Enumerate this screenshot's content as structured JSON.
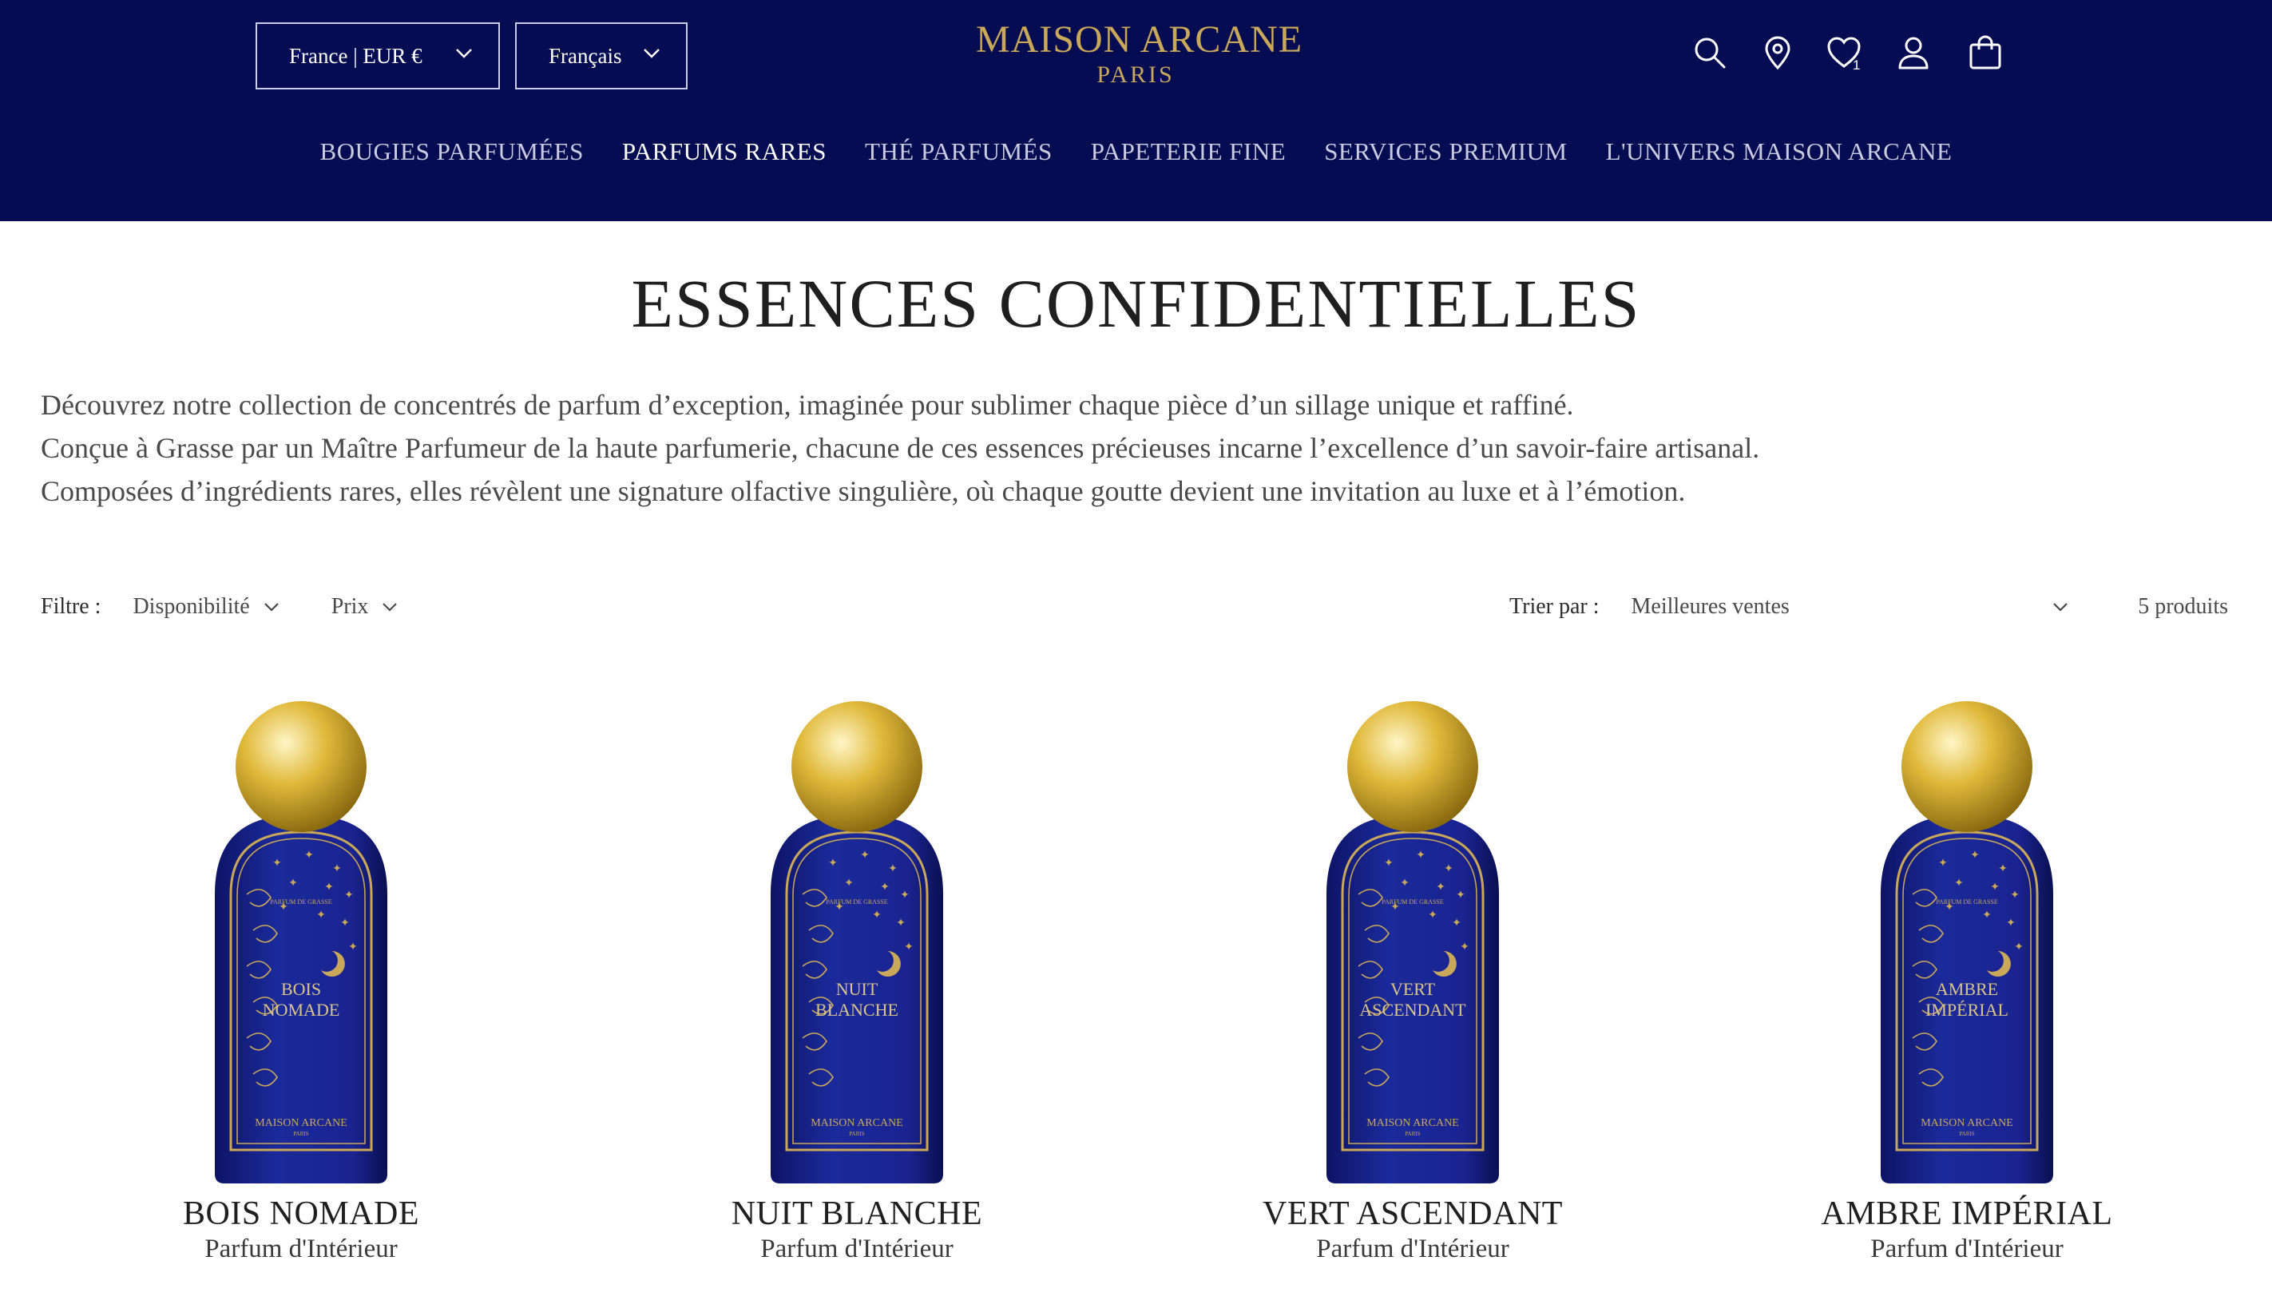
{
  "header": {
    "country_selector": "France | EUR €",
    "language_selector": "Français",
    "brand": "MAISON ARCANE",
    "city": "PARIS",
    "wishlist_count": "1",
    "nav": [
      {
        "label": "BOUGIES PARFUMÉES",
        "active": false
      },
      {
        "label": "PARFUMS RARES",
        "active": true
      },
      {
        "label": "THÉ PARFUMÉS",
        "active": false
      },
      {
        "label": "PAPETERIE FINE",
        "active": false
      },
      {
        "label": "SERVICES PREMIUM",
        "active": false
      },
      {
        "label": "L'UNIVERS MAISON ARCANE",
        "active": false
      }
    ]
  },
  "page": {
    "title": "ESSENCES CONFIDENTIELLES",
    "intro": [
      "Découvrez notre collection de concentrés de parfum d’exception, imaginée pour sublimer chaque pièce d’un sillage unique et raffiné.",
      "Conçue à Grasse par un Maître Parfumeur de la haute parfumerie, chacune de ces essences précieuses incarne l’excellence d’un savoir-faire artisanal.",
      "Composées d’ingrédients rares, elles révèlent une signature olfactive singulière, où chaque goutte devient une invitation au luxe et à l’émotion."
    ]
  },
  "toolbar": {
    "filter_label": "Filtre :",
    "filter_availability": "Disponibilité",
    "filter_price": "Prix",
    "sort_label": "Trier par :",
    "sort_value": "Meilleures ventes",
    "product_count": "5 produits"
  },
  "products": [
    {
      "name": "BOIS NOMADE",
      "type": "Parfum d'Intérieur",
      "label_line1": "BOIS",
      "label_line2": "NOMADE"
    },
    {
      "name": "NUIT BLANCHE",
      "type": "Parfum d'Intérieur",
      "label_line1": "NUIT",
      "label_line2": "BLANCHE"
    },
    {
      "name": "VERT ASCENDANT",
      "type": "Parfum d'Intérieur",
      "label_line1": "VERT",
      "label_line2": "ASCENDANT"
    },
    {
      "name": "AMBRE IMPÉRIAL",
      "type": "Parfum d'Intérieur",
      "label_line1": "AMBRE",
      "label_line2": "IMPÉRIAL"
    }
  ],
  "bottle_label": {
    "top": "PARFUM DE GRASSE",
    "brand": "MAISON ARCANE",
    "city": "PARIS"
  },
  "colors": {
    "header_bg": "#050c52",
    "gold": "#c9a85a",
    "bottle_blue": "#1b2a9a"
  },
  "icons": [
    "search-icon",
    "store-locator-icon",
    "wishlist-icon",
    "account-icon",
    "cart-icon",
    "chevron-down-icon"
  ]
}
